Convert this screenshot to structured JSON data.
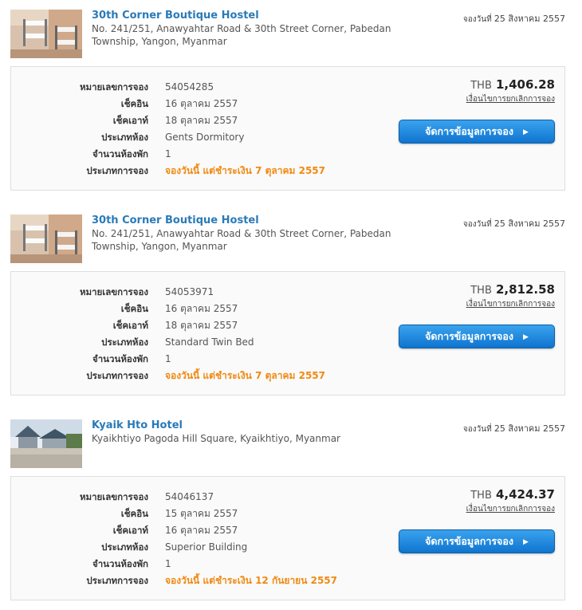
{
  "booked_label": "จองวันที่",
  "labels": {
    "booking_number": "หมายเลขการจอง",
    "check_in": "เช็คอิน",
    "check_out": "เช็คเอาท์",
    "room_type": "ประเภทห้อง",
    "rooms": "จำนวนห้องพัก",
    "booking_type": "ประเภทการจอง"
  },
  "cancel_label": "เงื่อนไขการยกเลิกการจอง",
  "manage_label": "จัดการข้อมูลการจอง",
  "bookings": [
    {
      "hotel_name": "30th Corner Boutique Hostel",
      "address": "No. 241/251, Anawyahtar Road & 30th Street Corner, Pabedan Township, Yangon, Myanmar",
      "booked_date": "25 สิงหาคม 2557",
      "booking_number": "54054285",
      "check_in": "16 ตุลาคม 2557",
      "check_out": "18 ตุลาคม 2557",
      "room_type": "Gents Dormitory",
      "rooms": "1",
      "booking_type": "จองวันนี้ แต่ชำระเงิน 7 ตุลาคม 2557",
      "currency": "THB",
      "amount": "1,406.28",
      "image": "dormitory-room-photo"
    },
    {
      "hotel_name": "30th Corner Boutique Hostel",
      "address": "No. 241/251, Anawyahtar Road & 30th Street Corner, Pabedan Township, Yangon, Myanmar",
      "booked_date": "25 สิงหาคม 2557",
      "booking_number": "54053971",
      "check_in": "16 ตุลาคม 2557",
      "check_out": "18 ตุลาคม 2557",
      "room_type": "Standard Twin Bed",
      "rooms": "1",
      "booking_type": "จองวันนี้ แต่ชำระเงิน 7 ตุลาคม 2557",
      "currency": "THB",
      "amount": "2,812.58",
      "image": "dormitory-room-photo"
    },
    {
      "hotel_name": "Kyaik Hto Hotel",
      "address": "Kyaikhtiyo Pagoda Hill Square, Kyaikhtiyo, Myanmar",
      "booked_date": "25 สิงหาคม 2557",
      "booking_number": "54046137",
      "check_in": "15 ตุลาคม 2557",
      "check_out": "16 ตุลาคม 2557",
      "room_type": "Superior Building",
      "rooms": "1",
      "booking_type": "จองวันนี้ แต่ชำระเงิน 12 กันยายน 2557",
      "currency": "THB",
      "amount": "4,424.37",
      "image": "hotel-exterior-photo"
    }
  ]
}
